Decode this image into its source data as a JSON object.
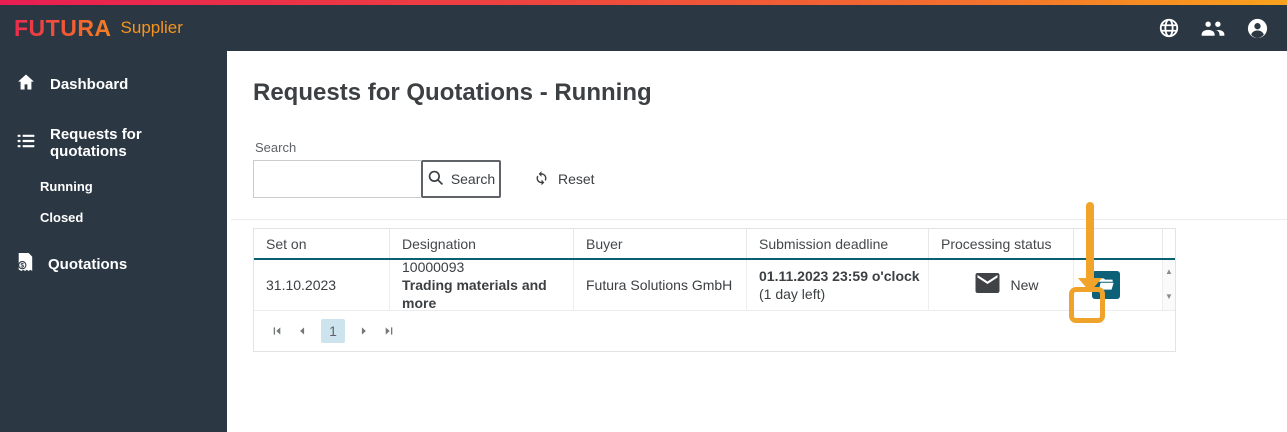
{
  "brand": {
    "name": "FUTURA",
    "product": "Supplier"
  },
  "header": {
    "icons": [
      "globe-icon",
      "users-icon",
      "account-icon"
    ]
  },
  "sidebar": {
    "items": [
      "Dashboard",
      "Requests for quotations",
      "Running",
      "Closed",
      "Quotations"
    ]
  },
  "page": {
    "title": "Requests for Quotations - Running"
  },
  "search": {
    "label": "Search",
    "value": "",
    "button_label": "Search",
    "reset_label": "Reset"
  },
  "table": {
    "columns": [
      "Set on",
      "Designation",
      "Buyer",
      "Submission deadline",
      "Processing status"
    ],
    "row": {
      "set_on": "31.10.2023",
      "designation_number": "10000093",
      "designation_name": "Trading materials and more",
      "buyer": "Futura Solutions GmbH",
      "deadline": "01.11.2023 23:59 o'clock",
      "deadline_note": "(1 day left)",
      "status": "New",
      "status_icon": "mail-icon",
      "action_icon": "folder-open-icon"
    }
  },
  "scrollbar": {
    "up": "▲",
    "down": "▼"
  },
  "pagination": {
    "current_page": "1"
  },
  "annotation": {
    "shape": "arrow-pointing-to-open-button",
    "color": "#f0a32a"
  },
  "colors": {
    "header_bg": "#2b3743",
    "accent_gradient_start": "#e81e52",
    "accent_gradient_end": "#f9a21d",
    "brand_orange": "#f7941d",
    "table_header_border": "#0a6073",
    "action_button": "#0c6078",
    "page_active_bg": "#cde4ef"
  }
}
